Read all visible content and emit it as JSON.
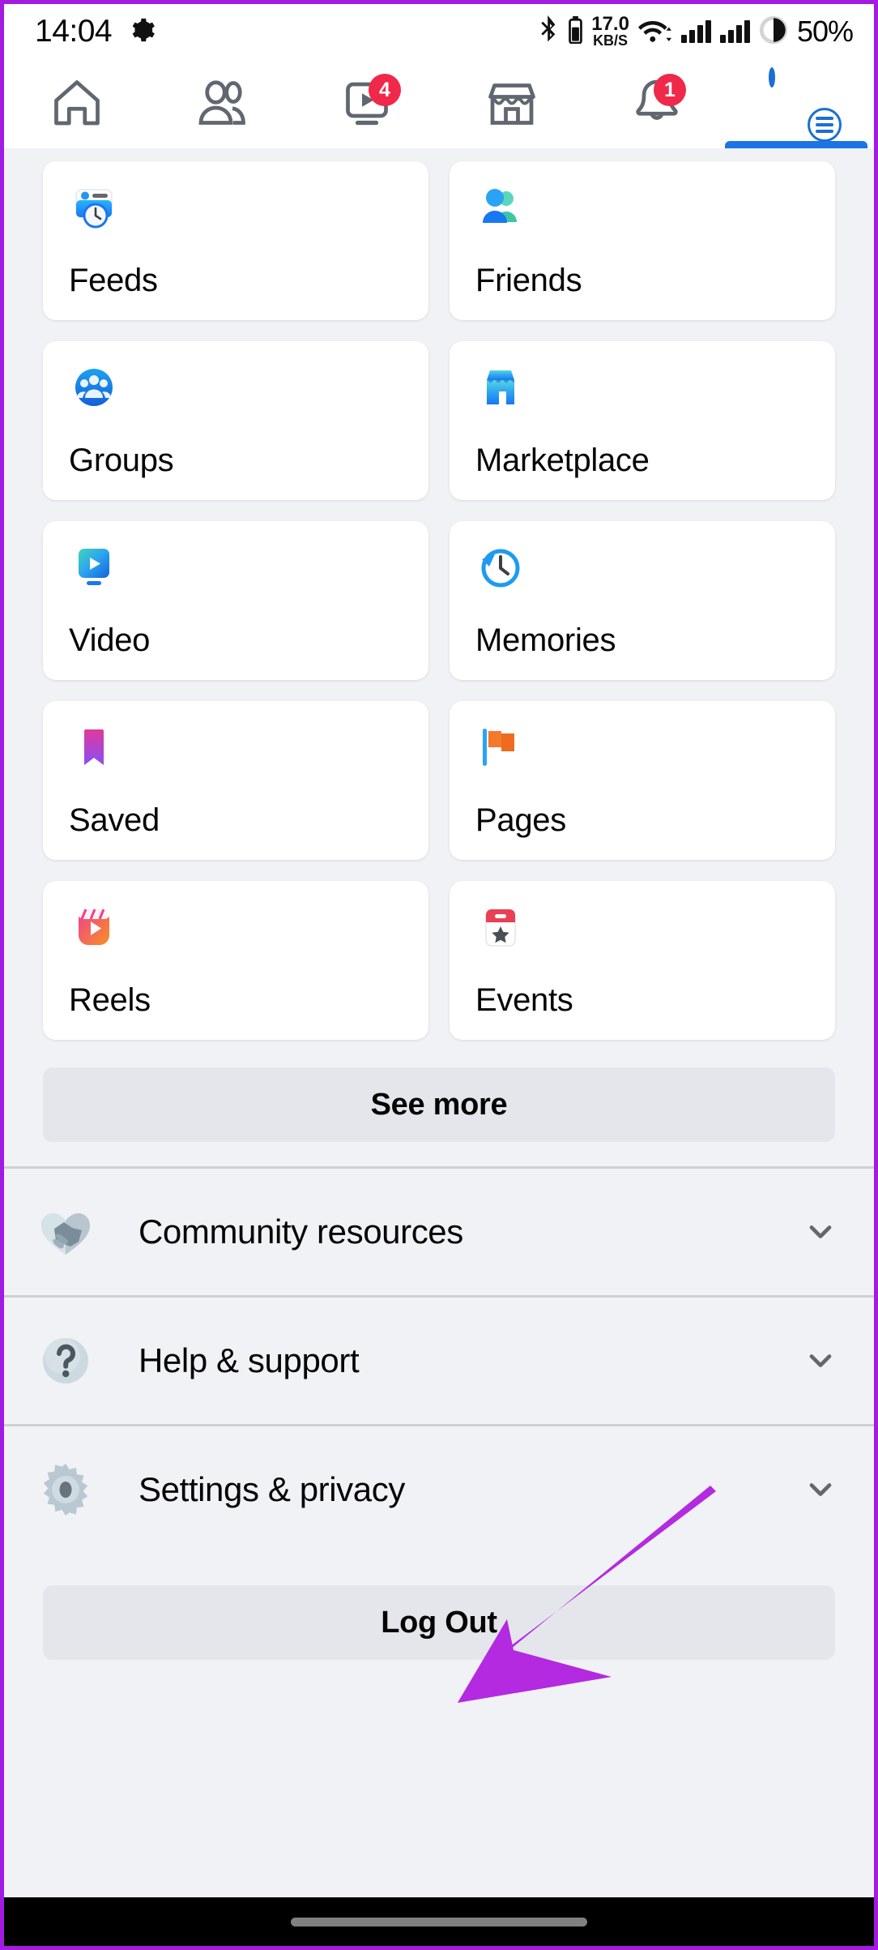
{
  "status_bar": {
    "time": "14:04",
    "gear_icon": "gear-icon",
    "bluetooth_icon": "bluetooth-icon",
    "bluetooth_battery_icon": "bluetooth-battery-icon",
    "net_speed_value": "17.0",
    "net_speed_unit": "KB/S",
    "wifi_icon": "wifi-icon",
    "signal_icon_1": "cellular-signal-icon",
    "signal_icon_2": "cellular-signal-icon",
    "battery_icon": "battery-circle-icon",
    "battery_percent": "50%"
  },
  "top_nav": {
    "items": [
      {
        "name": "home",
        "icon": "home-icon",
        "badge": ""
      },
      {
        "name": "friends",
        "icon": "friends-icon",
        "badge": ""
      },
      {
        "name": "video",
        "icon": "video-icon",
        "badge": "4"
      },
      {
        "name": "marketplace",
        "icon": "marketplace-icon",
        "badge": ""
      },
      {
        "name": "notifications",
        "icon": "bell-icon",
        "badge": "1"
      },
      {
        "name": "menu-profile",
        "icon": "profile-avatar",
        "badge": ""
      }
    ],
    "active_tab": "menu-profile"
  },
  "shortcuts": [
    {
      "label": "Feeds",
      "icon": "feeds-icon"
    },
    {
      "label": "Friends",
      "icon": "friends-color-icon"
    },
    {
      "label": "Groups",
      "icon": "groups-icon"
    },
    {
      "label": "Marketplace",
      "icon": "marketplace-color-icon"
    },
    {
      "label": "Video",
      "icon": "video-color-icon"
    },
    {
      "label": "Memories",
      "icon": "memories-icon"
    },
    {
      "label": "Saved",
      "icon": "saved-bookmark-icon"
    },
    {
      "label": "Pages",
      "icon": "pages-flag-icon"
    },
    {
      "label": "Reels",
      "icon": "reels-icon"
    },
    {
      "label": "Events",
      "icon": "events-icon"
    }
  ],
  "see_more_label": "See more",
  "sections": [
    {
      "label": "Community resources",
      "icon": "handshake-heart-icon",
      "chevron": "chevron-down-icon"
    },
    {
      "label": "Help & support",
      "icon": "question-mark-icon",
      "chevron": "chevron-down-icon"
    },
    {
      "label": "Settings & privacy",
      "icon": "gear-icon",
      "chevron": "chevron-down-icon"
    }
  ],
  "logout_label": "Log Out",
  "annotation": {
    "type": "arrow",
    "color": "#b32ae0",
    "points_to": "Settings & privacy"
  },
  "colors": {
    "accent_blue": "#1b74e4",
    "badge_red": "#f02849",
    "page_bg": "#f0f2f5",
    "card_bg": "#ffffff",
    "button_bg": "#e4e6eb",
    "annotation_purple": "#b32ae0",
    "frame_purple": "#a21be0"
  }
}
